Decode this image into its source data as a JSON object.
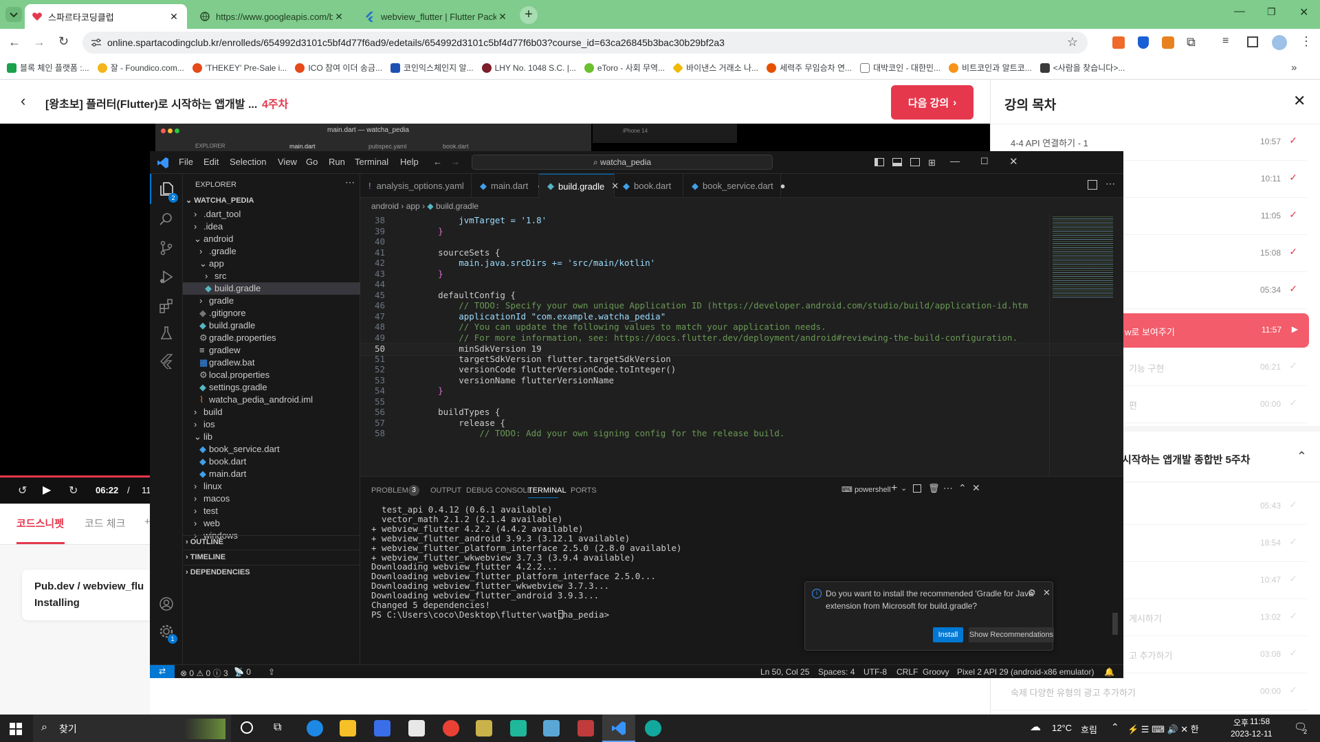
{
  "browser": {
    "tabs": [
      {
        "title": "스파르타코딩클럽",
        "active": true
      },
      {
        "title": "https://www.googleapis.com/b",
        "active": false
      },
      {
        "title": "webview_flutter | Flutter Packa",
        "active": false
      }
    ],
    "url": "online.spartacodingclub.kr/enrolleds/654992d3101c5bf4d77f6ad9/edetails/654992d3101c5bf4d77f6b03?course_id=63ca26845b3bac30b29bf2a3",
    "bookmarks": [
      "블록 체인 플랫폼 :...",
      "잘 - Foundico.com...",
      "'THEKEY' Pre-Sale i...",
      "ICO 참여 이더 송금...",
      "코인익스체인지 알...",
      "LHY No. 1048 S.C. |...",
      "eToro - 사회 무역...",
      "바이낸스 거래소 나...",
      "세력주 무임승차 연...",
      "대박코인 - 대한민...",
      "비트코인과 알트코...",
      "<사람을 찾습니다>..."
    ]
  },
  "page": {
    "course_title": "[왕초보] 플러터(Flutter)로 시작하는 앱개발 ...",
    "week": "4주차",
    "next_button": "다음 강의",
    "player": {
      "time_current": "06:22",
      "separator": "/",
      "time_total": "11"
    },
    "subtabs": [
      "코드스니펫",
      "코드 체크",
      "+"
    ],
    "snippet_line1": "Pub.dev / webview_flu",
    "snippet_line2": "Installing"
  },
  "toc": {
    "title": "강의 목차",
    "items": [
      {
        "label": "4-4  API 연결하기 - 1",
        "time": "10:57",
        "done": true
      },
      {
        "label": "",
        "time": "10:11",
        "done": true
      },
      {
        "label": "",
        "time": "11:05",
        "done": true
      },
      {
        "label": "",
        "time": "15:08",
        "done": true
      },
      {
        "label": "",
        "time": "05:34",
        "done": true
      },
      {
        "label": "w로 보여주기",
        "time": "11:57",
        "active": true
      },
      {
        "label": "기능 구현",
        "time": "06:21"
      },
      {
        "label": "편",
        "time": "00:00"
      }
    ],
    "section_title": "시작하는 앱개발 종합반 5주차",
    "items2": [
      {
        "label": "",
        "time": "05:43"
      },
      {
        "label": "",
        "time": "18:54"
      },
      {
        "label": "",
        "time": "10:47"
      },
      {
        "label": "게시하기",
        "time": "13:02"
      },
      {
        "label": "고 추가하기",
        "time": "03:08"
      },
      {
        "label": "숙제  다양한 유형의 광고 추가하기",
        "time": "00:00"
      }
    ]
  },
  "bg_window": {
    "title": "main.dart — watcha_pedia",
    "tabs": [
      "EXPLORER",
      "main.dart",
      "pubspec.yaml",
      "book.dart"
    ],
    "device": "iPhone 14"
  },
  "vscode": {
    "menu": [
      "File",
      "Edit",
      "Selection",
      "View",
      "Go",
      "Run",
      "Terminal",
      "Help"
    ],
    "search": "watcha_pedia",
    "explorer_title": "EXPLORER",
    "project": "WATCHA_PEDIA",
    "tree": [
      {
        "label": ".dart_tool",
        "indent": 1,
        "kind": "folder-closed"
      },
      {
        "label": ".idea",
        "indent": 1,
        "kind": "folder-closed"
      },
      {
        "label": "android",
        "indent": 1,
        "kind": "folder-open"
      },
      {
        "label": ".gradle",
        "indent": 2,
        "kind": "folder-closed"
      },
      {
        "label": "app",
        "indent": 2,
        "kind": "folder-open"
      },
      {
        "label": "src",
        "indent": 3,
        "kind": "folder-closed"
      },
      {
        "label": "build.gradle",
        "indent": 3,
        "kind": "gradle",
        "selected": true
      },
      {
        "label": "gradle",
        "indent": 2,
        "kind": "folder-closed"
      },
      {
        "label": ".gitignore",
        "indent": 2,
        "kind": "git"
      },
      {
        "label": "build.gradle",
        "indent": 2,
        "kind": "gradle"
      },
      {
        "label": "gradle.properties",
        "indent": 2,
        "kind": "gear"
      },
      {
        "label": "gradlew",
        "indent": 2,
        "kind": "lines"
      },
      {
        "label": "gradlew.bat",
        "indent": 2,
        "kind": "win"
      },
      {
        "label": "local.properties",
        "indent": 2,
        "kind": "gear"
      },
      {
        "label": "settings.gradle",
        "indent": 2,
        "kind": "gradle"
      },
      {
        "label": "watcha_pedia_android.iml",
        "indent": 2,
        "kind": "rss"
      },
      {
        "label": "build",
        "indent": 1,
        "kind": "folder-closed"
      },
      {
        "label": "ios",
        "indent": 1,
        "kind": "folder-closed"
      },
      {
        "label": "lib",
        "indent": 1,
        "kind": "folder-open"
      },
      {
        "label": "book_service.dart",
        "indent": 2,
        "kind": "dart"
      },
      {
        "label": "book.dart",
        "indent": 2,
        "kind": "dart"
      },
      {
        "label": "main.dart",
        "indent": 2,
        "kind": "dart"
      },
      {
        "label": "linux",
        "indent": 1,
        "kind": "folder-closed"
      },
      {
        "label": "macos",
        "indent": 1,
        "kind": "folder-closed"
      },
      {
        "label": "test",
        "indent": 1,
        "kind": "folder-closed"
      },
      {
        "label": "web",
        "indent": 1,
        "kind": "folder-closed"
      },
      {
        "label": "windows",
        "indent": 1,
        "kind": "folder-closed"
      }
    ],
    "sections": [
      "OUTLINE",
      "TIMELINE",
      "DEPENDENCIES"
    ],
    "editor_tabs": [
      {
        "label": "analysis_options.yaml",
        "icon": "!",
        "dot": false
      },
      {
        "label": "main.dart",
        "icon": "dart",
        "dot": true
      },
      {
        "label": "build.gradle",
        "icon": "gradle",
        "active": true
      },
      {
        "label": "book.dart",
        "icon": "dart",
        "dot": false
      },
      {
        "label": "book_service.dart",
        "icon": "dart",
        "dot": true
      }
    ],
    "breadcrumb": [
      "android",
      "app",
      "build.gradle"
    ],
    "code": [
      {
        "n": "38",
        "t": "        jvmTarget = '1.8'"
      },
      {
        "n": "39",
        "t": "    }"
      },
      {
        "n": "40",
        "t": ""
      },
      {
        "n": "41",
        "t": "    sourceSets {"
      },
      {
        "n": "42",
        "t": "        main.java.srcDirs += 'src/main/kotlin'"
      },
      {
        "n": "43",
        "t": "    }"
      },
      {
        "n": "44",
        "t": ""
      },
      {
        "n": "45",
        "t": "    defaultConfig {"
      },
      {
        "n": "46",
        "t": "        // TODO: Specify your own unique Application ID (https://developer.android.com/studio/build/application-id.htm"
      },
      {
        "n": "47",
        "t": "        applicationId \"com.example.watcha_pedia\""
      },
      {
        "n": "48",
        "t": "        // You can update the following values to match your application needs."
      },
      {
        "n": "49",
        "t": "        // For more information, see: https://docs.flutter.dev/deployment/android#reviewing-the-build-configuration."
      },
      {
        "n": "50",
        "t": "        minSdkVersion 19"
      },
      {
        "n": "51",
        "t": "        targetSdkVersion flutter.targetSdkVersion"
      },
      {
        "n": "52",
        "t": "        versionCode flutterVersionCode.toInteger()"
      },
      {
        "n": "53",
        "t": "        versionName flutterVersionName"
      },
      {
        "n": "54",
        "t": "    }"
      },
      {
        "n": "55",
        "t": ""
      },
      {
        "n": "56",
        "t": "    buildTypes {"
      },
      {
        "n": "57",
        "t": "        release {"
      },
      {
        "n": "58",
        "t": "            // TODO: Add your own signing config for the release build."
      }
    ],
    "panel_tabs": [
      "PROBLEMS",
      "OUTPUT",
      "DEBUG CONSOLE",
      "TERMINAL",
      "PORTS"
    ],
    "problems_count": "3",
    "shell": "powershell",
    "terminal": [
      "  test_api 0.4.12 (0.6.1 available)",
      "  vector_math 2.1.2 (2.1.4 available)",
      "+ webview_flutter 4.2.2 (4.4.2 available)",
      "+ webview_flutter_android 3.9.3 (3.12.1 available)",
      "+ webview_flutter_platform_interface 2.5.0 (2.8.0 available)",
      "+ webview_flutter_wkwebview 3.7.3 (3.9.4 available)",
      "Downloading webview_flutter 4.2.2...",
      "Downloading webview_flutter_platform_interface 2.5.0...",
      "Downloading webview_flutter_wkwebview 3.7.3...",
      "Downloading webview_flutter_android 3.9.3...",
      "Changed 5 dependencies!",
      "PS C:\\Users\\coco\\Desktop\\flutter\\watcha_pedia> "
    ],
    "notification": {
      "text1": "Do you want to install the recommended 'Gradle for Java'",
      "text2": "extension from Microsoft for build.gradle?",
      "install": "Install",
      "show": "Show Recommendations"
    },
    "status": {
      "errors": "0",
      "warnings": "0",
      "infos": "3",
      "ports": "0",
      "position": "Ln 50, Col 25",
      "spaces": "Spaces: 4",
      "encoding": "UTF-8",
      "eol": "CRLF",
      "language": "Groovy",
      "device": "Pixel 2 API 29 (android-x86 emulator)"
    },
    "badges": {
      "explorer": "2",
      "settings": "1"
    }
  },
  "taskbar": {
    "search": "찾기",
    "weather_temp": "12°C",
    "weather_desc": "흐림",
    "ampm": "오후",
    "time": "11:58",
    "date": "2023-12-11",
    "notif_count": "2"
  },
  "colors": {
    "accent_red": "#e5384d",
    "vscode_blue": "#0078d4",
    "tab_green": "#7fcc8c"
  }
}
